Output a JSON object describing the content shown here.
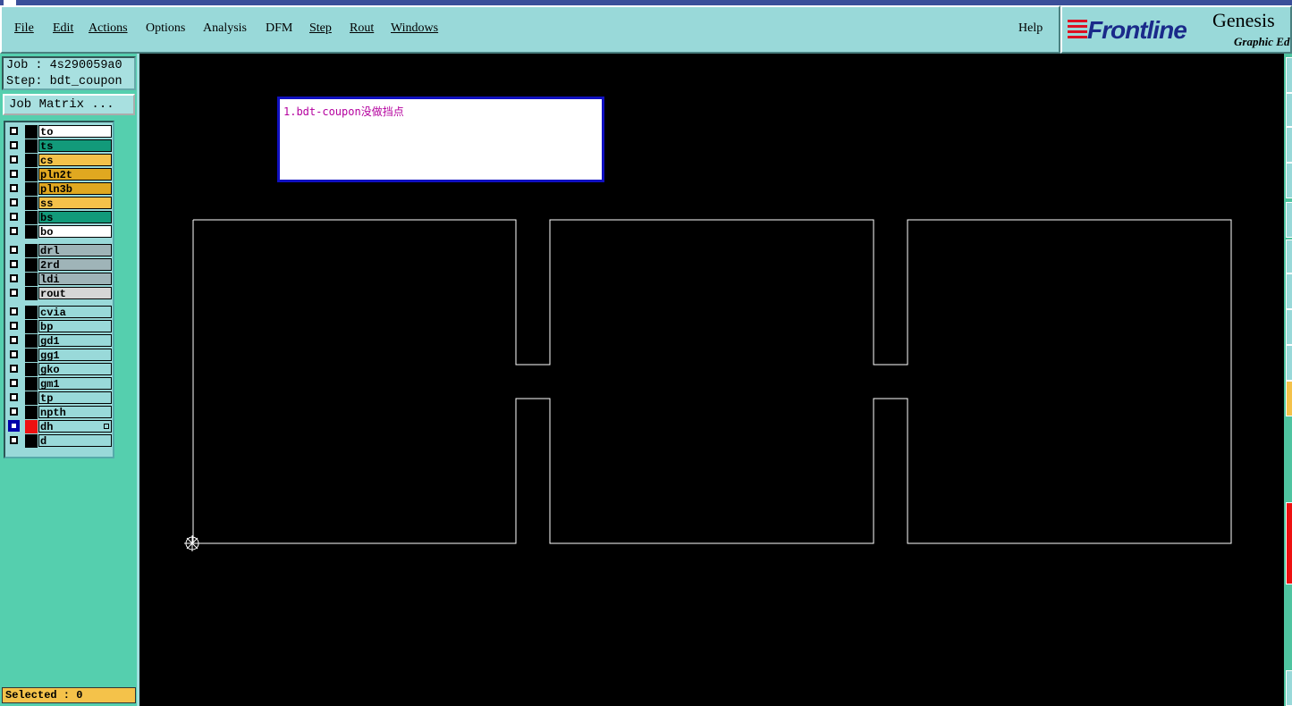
{
  "menu": {
    "items": [
      {
        "label": "File",
        "name": "menu-file"
      },
      {
        "label": "Edit",
        "name": "menu-edit"
      },
      {
        "label": "Actions",
        "name": "menu-actions"
      },
      {
        "label": "Options",
        "name": "menu-options"
      },
      {
        "label": "Analysis",
        "name": "menu-analysis"
      },
      {
        "label": "DFM",
        "name": "menu-dfm"
      },
      {
        "label": "Step",
        "name": "menu-step"
      },
      {
        "label": "Rout",
        "name": "menu-rout"
      },
      {
        "label": "Windows",
        "name": "menu-windows"
      }
    ],
    "help": "Help"
  },
  "logo": {
    "brand": "Frontline",
    "product": "Genesis",
    "subtitle": "Graphic Ed"
  },
  "job": {
    "job_line": "Job : 4s290059a0",
    "step_line": "Step: bdt_coupon",
    "matrix_button": "Job Matrix ..."
  },
  "layers": [
    {
      "name": "to",
      "color": "#ffffff"
    },
    {
      "name": "ts",
      "color": "#129a7a"
    },
    {
      "name": "cs",
      "color": "#f4c24a"
    },
    {
      "name": "pln2t",
      "color": "#e0a820"
    },
    {
      "name": "pln3b",
      "color": "#e0a820"
    },
    {
      "name": "ss",
      "color": "#f4c24a"
    },
    {
      "name": "bs",
      "color": "#129a7a"
    },
    {
      "name": "bo",
      "color": "#ffffff"
    },
    {
      "name": "drl",
      "color": "#9fb4b8"
    },
    {
      "name": "2rd",
      "color": "#9fb4b8"
    },
    {
      "name": "ldi",
      "color": "#9fb4b8"
    },
    {
      "name": "rout",
      "color": "#d6d6d6"
    },
    {
      "name": "cvia",
      "color": "#99d9d9"
    },
    {
      "name": "bp",
      "color": "#99d9d9"
    },
    {
      "name": "gd1",
      "color": "#99d9d9"
    },
    {
      "name": "gg1",
      "color": "#99d9d9"
    },
    {
      "name": "gko",
      "color": "#99d9d9"
    },
    {
      "name": "gm1",
      "color": "#99d9d9"
    },
    {
      "name": "tp",
      "color": "#99d9d9"
    },
    {
      "name": "npth",
      "color": "#99d9d9"
    },
    {
      "name": "dh",
      "color": "#99d9d9",
      "active": true
    },
    {
      "name": "d",
      "color": "#99d9d9"
    }
  ],
  "status": {
    "selected": "Selected : 0"
  },
  "note": {
    "text": "1.bdt-coupon没做挡点"
  },
  "colors": {
    "canvas_bg": "#000000",
    "outline": "#ffffff",
    "note_text": "#b4009e",
    "note_border": "#1010c0"
  }
}
